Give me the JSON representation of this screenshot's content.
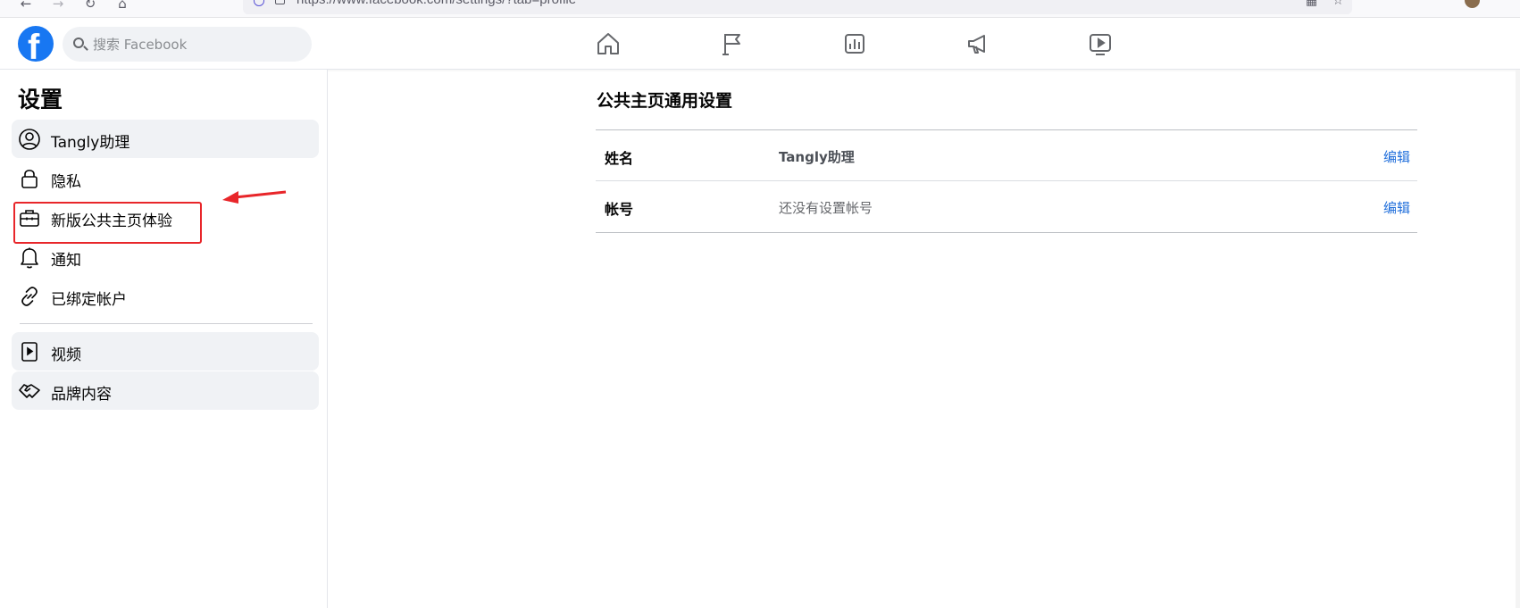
{
  "browser": {
    "url": "https://www.facebook.com/settings/?tab=profile",
    "back_icon": "arrow-left-icon",
    "forward_icon": "arrow-right-icon",
    "reload_icon": "reload-icon",
    "home_icon": "home-icon"
  },
  "topnav": {
    "logo_letter": "f",
    "search_placeholder": "搜索 Facebook",
    "nav_icons": [
      "home-icon",
      "flag-icon",
      "chart-icon",
      "megaphone-icon",
      "video-icon"
    ],
    "brand_color": "#1877f2"
  },
  "sidebar": {
    "title": "设置",
    "items": [
      {
        "label": "Tangly助理",
        "icon": "user-circle-icon",
        "active": true
      },
      {
        "label": "隐私",
        "icon": "lock-icon",
        "active": false
      },
      {
        "label": "新版公共主页体验",
        "icon": "briefcase-icon",
        "active": false
      },
      {
        "label": "通知",
        "icon": "bell-icon",
        "active": false
      },
      {
        "label": "已绑定帐户",
        "icon": "link-icon",
        "active": false
      },
      {
        "label": "视频",
        "icon": "video-file-icon",
        "active": true
      },
      {
        "label": "品牌内容",
        "icon": "handshake-icon",
        "active": true
      }
    ]
  },
  "main": {
    "title": "公共主页通用设置",
    "rows": [
      {
        "key": "姓名",
        "value": "Tangly助理",
        "action": "编辑"
      },
      {
        "key": "帐号",
        "value": "还没有设置帐号",
        "action": "编辑"
      }
    ],
    "link_color": "#216fdb"
  },
  "annotation": {
    "highlight_color": "#e8262a"
  }
}
